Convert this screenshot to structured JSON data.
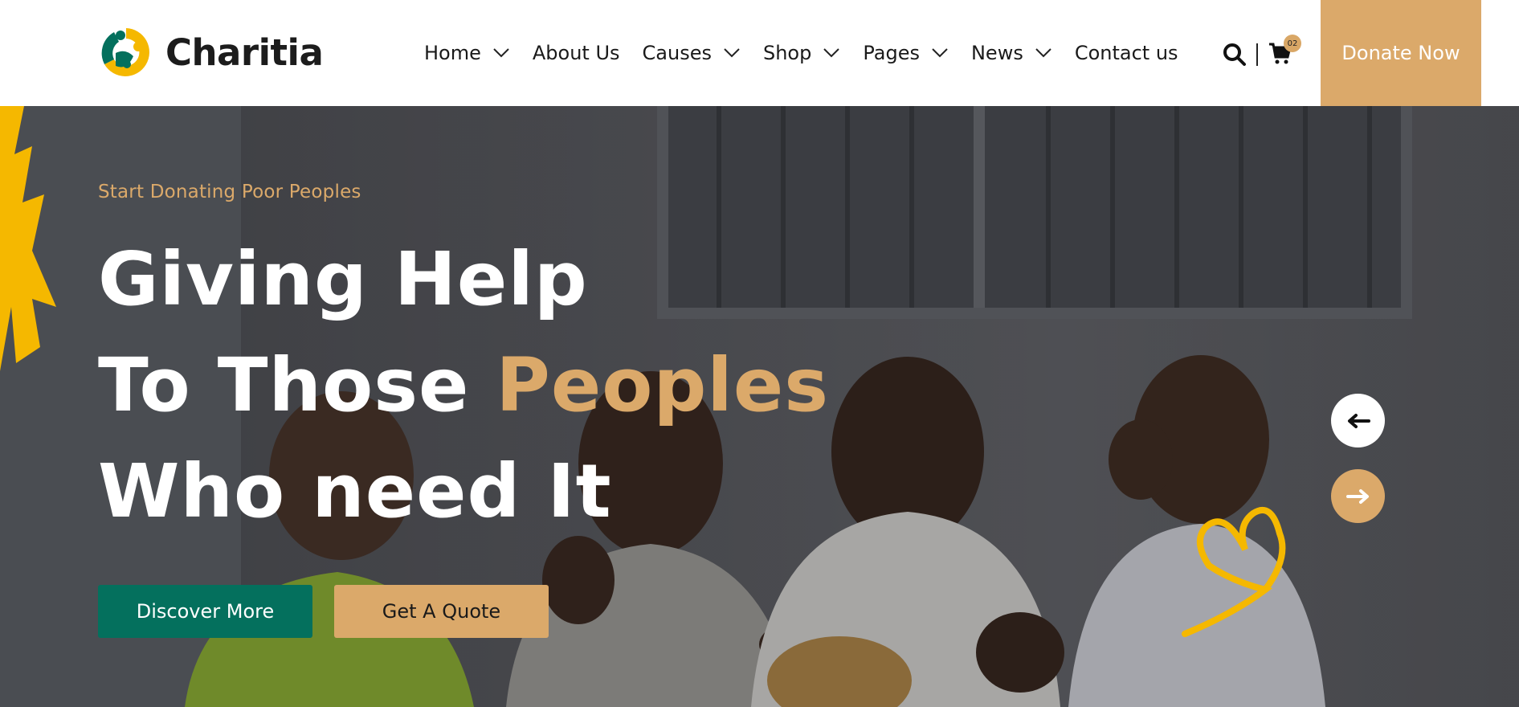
{
  "brand": {
    "name": "Charitia"
  },
  "nav": {
    "items": [
      {
        "label": "Home",
        "has_dropdown": true
      },
      {
        "label": "About Us",
        "has_dropdown": false
      },
      {
        "label": "Causes",
        "has_dropdown": true
      },
      {
        "label": "Shop",
        "has_dropdown": true
      },
      {
        "label": "Pages",
        "has_dropdown": true
      },
      {
        "label": "News",
        "has_dropdown": true
      },
      {
        "label": "Contact us",
        "has_dropdown": false
      }
    ]
  },
  "tools": {
    "cart_count": "02",
    "search_icon": "search-icon",
    "cart_icon": "cart-icon"
  },
  "header": {
    "donate_label": "Donate Now"
  },
  "hero": {
    "eyebrow": "Start Donating Poor Peoples",
    "line1": "Giving Help",
    "line2_prefix": "To Those ",
    "line2_accent": "Peoples",
    "line3": "Who need It",
    "discover_label": "Discover More",
    "quote_label": "Get A Quote"
  },
  "colors": {
    "accent": "#dba96a",
    "primary_green": "#04705d",
    "brush_yellow": "#f5b800"
  }
}
